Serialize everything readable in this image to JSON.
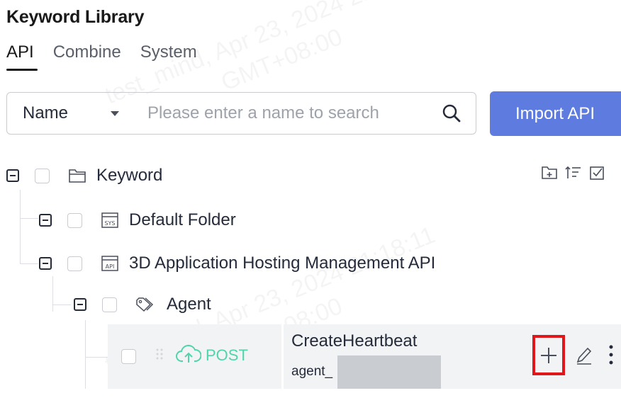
{
  "page": {
    "title": "Keyword Library"
  },
  "tabs": [
    {
      "label": "API",
      "active": true
    },
    {
      "label": "Combine",
      "active": false
    },
    {
      "label": "System",
      "active": false
    }
  ],
  "search": {
    "field_selected": "Name",
    "placeholder": "Please enter a name to search",
    "value": ""
  },
  "actions": {
    "import_label": "Import API"
  },
  "watermark": {
    "line1": "test_mind, Apr 23, 2024 21:18:11",
    "line2": "GMT+08:00"
  },
  "tree": {
    "root": {
      "label": "Keyword"
    },
    "folders": [
      {
        "label": "Default Folder",
        "icon": "sys-folder-icon"
      },
      {
        "label": "3D Application Hosting Management API",
        "icon": "api-folder-icon"
      }
    ],
    "group": {
      "label": "Agent",
      "icon": "tag-icon"
    },
    "api": {
      "method": "POST",
      "name": "CreateHeartbeat",
      "path": "agent_"
    },
    "toolbar_icons": [
      "add-folder-icon",
      "sort-icon",
      "batch-select-icon"
    ]
  },
  "colors": {
    "primary": "#5e7ce0",
    "post_method": "#50d4ab",
    "highlight": "#e0161a",
    "row_hover": "#f2f3f5"
  }
}
